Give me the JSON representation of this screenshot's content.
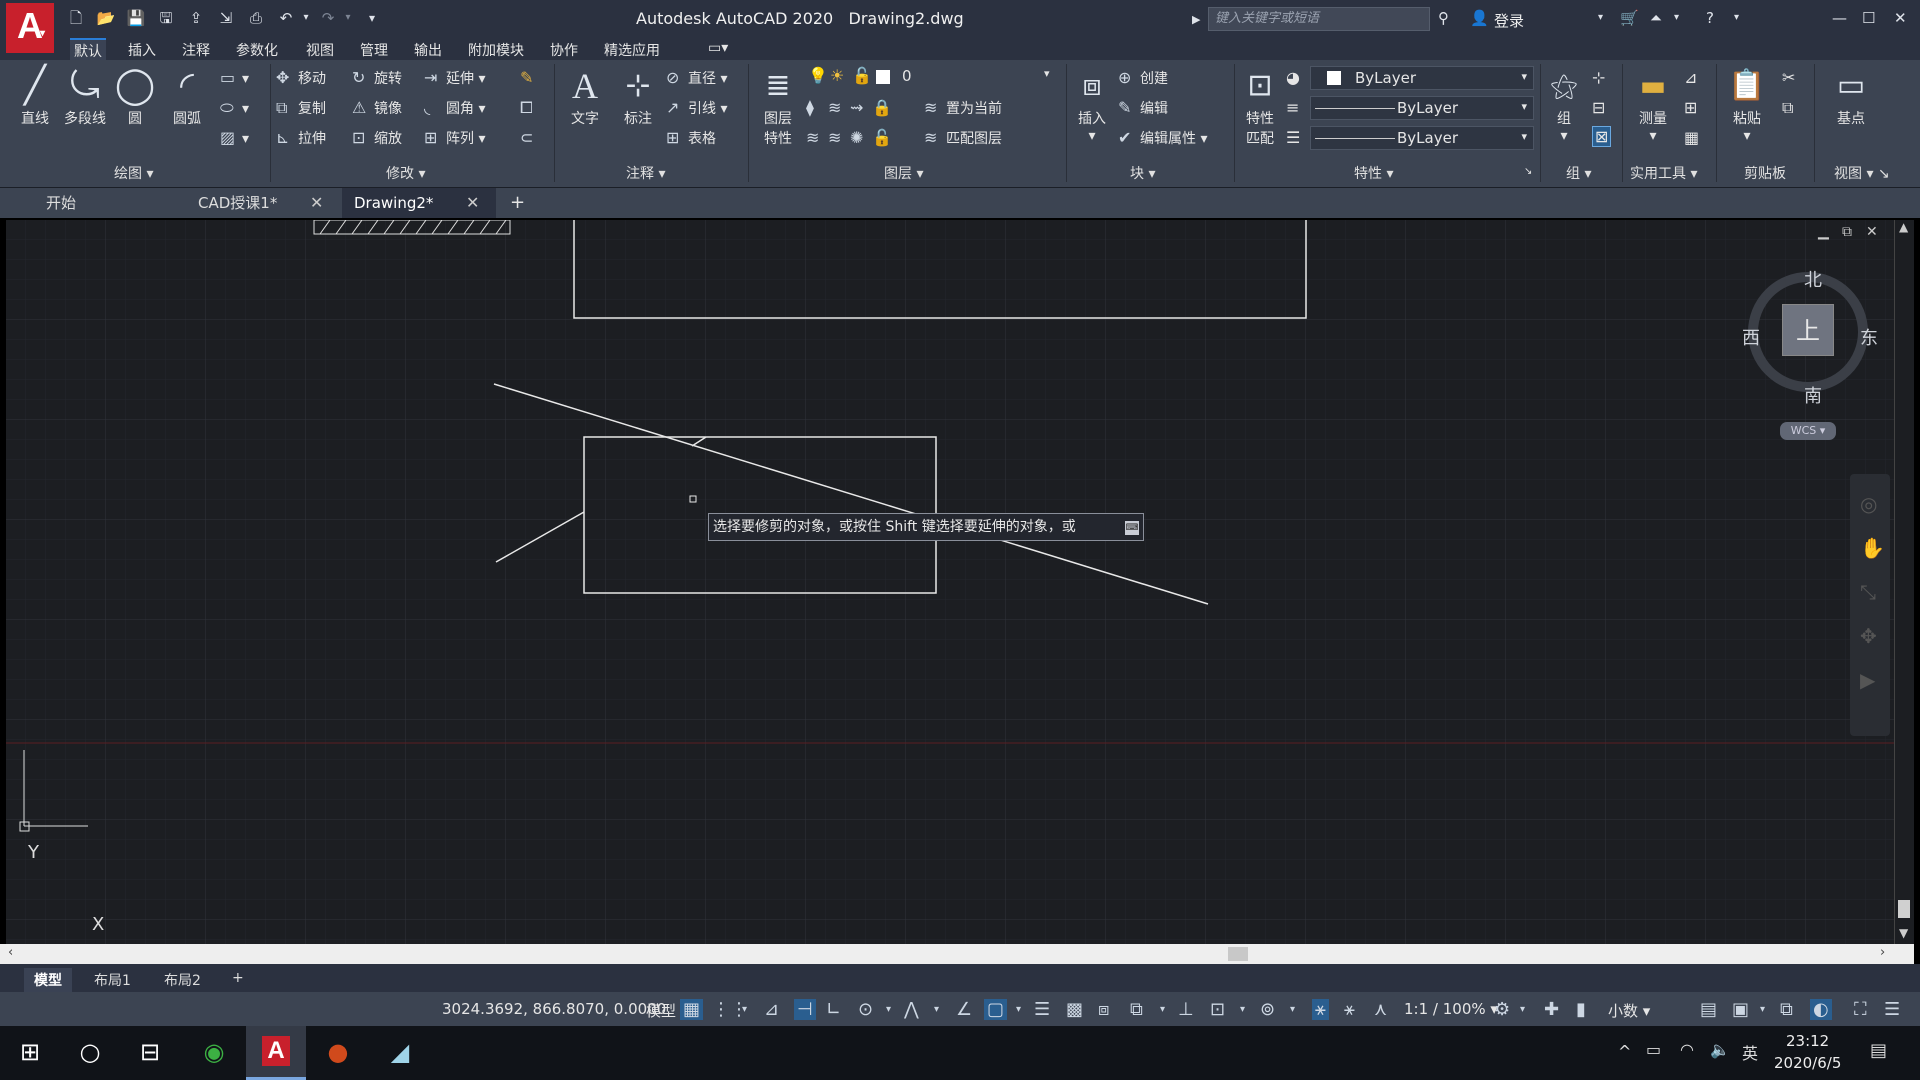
{
  "title": {
    "app": "Autodesk AutoCAD 2020",
    "file": "Drawing2.dwg",
    "search_placeholder": "键入关键字或短语",
    "signin": "登录"
  },
  "menu": [
    "默认",
    "插入",
    "注释",
    "参数化",
    "视图",
    "管理",
    "输出",
    "附加模块",
    "协作",
    "精选应用"
  ],
  "ribbon": {
    "draw": {
      "line": "直线",
      "polyline": "多段线",
      "circle": "圆",
      "arc": "圆弧",
      "group": "绘图"
    },
    "modify": {
      "move": "移动",
      "rotate": "旋转",
      "extend": "延伸",
      "copy": "复制",
      "mirror": "镜像",
      "fillet": "圆角",
      "stretch": "拉伸",
      "scale": "缩放",
      "array": "阵列",
      "group": "修改"
    },
    "annotation": {
      "text": "文字",
      "dim": "标注",
      "diameter": "直径",
      "leader": "引线",
      "table": "表格",
      "group": "注释"
    },
    "layers": {
      "props1": "图层",
      "props2": "特性",
      "current_layer": "0",
      "set_current": "置为当前",
      "match_layer": "匹配图层",
      "group": "图层"
    },
    "block": {
      "insert": "插入",
      "create": "创建",
      "edit": "编辑",
      "edit_attr": "编辑属性",
      "group": "块"
    },
    "properties": {
      "match1": "特性",
      "match2": "匹配",
      "color": "ByLayer",
      "linetype": "ByLayer",
      "lineweight": "ByLayer",
      "group": "特性"
    },
    "groups": {
      "group_btn": "组",
      "group": "组"
    },
    "utilities": {
      "measure": "测量",
      "group": "实用工具"
    },
    "clipboard": {
      "paste": "粘贴",
      "group": "剪贴板"
    },
    "view": {
      "base": "基点",
      "group": "视图"
    }
  },
  "tabs": {
    "start": "开始",
    "doc1": "CAD授课1*",
    "doc2": "Drawing2*",
    "add": "+"
  },
  "tooltip": "选择要修剪的对象，或按住 Shift 键选择要延伸的对象，或",
  "viewcube": {
    "north": "北",
    "south": "南",
    "east": "东",
    "west": "西",
    "face": "上",
    "wcs": "WCS"
  },
  "ucs": {
    "x": "X",
    "y": "Y"
  },
  "layout_tabs": {
    "model": "模型",
    "layout1": "布局1",
    "layout2": "布局2",
    "add": "+"
  },
  "status": {
    "coords": "3024.3692, 866.8070, 0.0000",
    "model": "模型",
    "scale": "1:1 / 100%",
    "units": "小数"
  },
  "taskbar": {
    "time": "23:12",
    "date": "2020/6/5",
    "ime": "英"
  },
  "colors": {
    "accent": "#2a7ed8",
    "canvas": "#1c1e22",
    "logo": "#c8202c"
  }
}
